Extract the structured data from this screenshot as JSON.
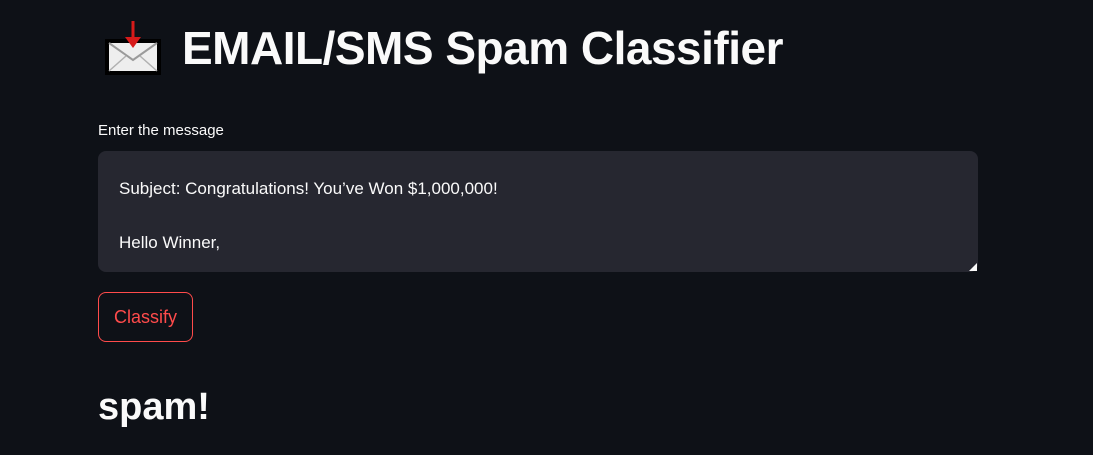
{
  "header": {
    "icon": "incoming-envelope-icon",
    "title": "EMAIL/SMS Spam Classifier"
  },
  "input": {
    "label": "Enter the message",
    "value": "Subject: Congratulations! You’ve Won $1,000,000!\n\nHello Winner,"
  },
  "actions": {
    "classify_label": "Classify"
  },
  "result": {
    "text": "spam!"
  },
  "colors": {
    "background": "#0e1117",
    "text": "#fafafa",
    "input_background": "#262730",
    "accent": "#ff4b4b"
  }
}
